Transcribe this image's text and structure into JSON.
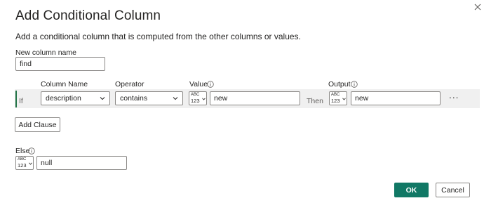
{
  "dialog": {
    "title": "Add Conditional Column",
    "description": "Add a conditional column that is computed from the other columns or values."
  },
  "new_column": {
    "label": "New column name",
    "value": "find"
  },
  "headers": {
    "column_name": "Column Name",
    "operator": "Operator",
    "value": "Value",
    "output": "Output"
  },
  "clause": {
    "if_label": "If",
    "column_name": "description",
    "operator": "contains",
    "value_type": {
      "top": "ABC",
      "bottom": "123"
    },
    "value": "new",
    "then_label": "Then",
    "output_type": {
      "top": "ABC",
      "bottom": "123"
    },
    "output": "new",
    "more_label": "···"
  },
  "add_clause_label": "Add Clause",
  "else": {
    "label": "Else",
    "type": {
      "top": "ABC",
      "bottom": "123"
    },
    "value": "null"
  },
  "footer": {
    "ok_label": "OK",
    "cancel_label": "Cancel"
  },
  "colors": {
    "accent": "#117865",
    "row_accent": "#217346",
    "row_band": "#f0f0f0",
    "border": "#8a8886"
  },
  "icons": {
    "close": "close-icon",
    "info": "info-icon",
    "dropdown": "chevron-down-icon",
    "type": "data-type-any-icon",
    "more": "more-options-icon"
  }
}
